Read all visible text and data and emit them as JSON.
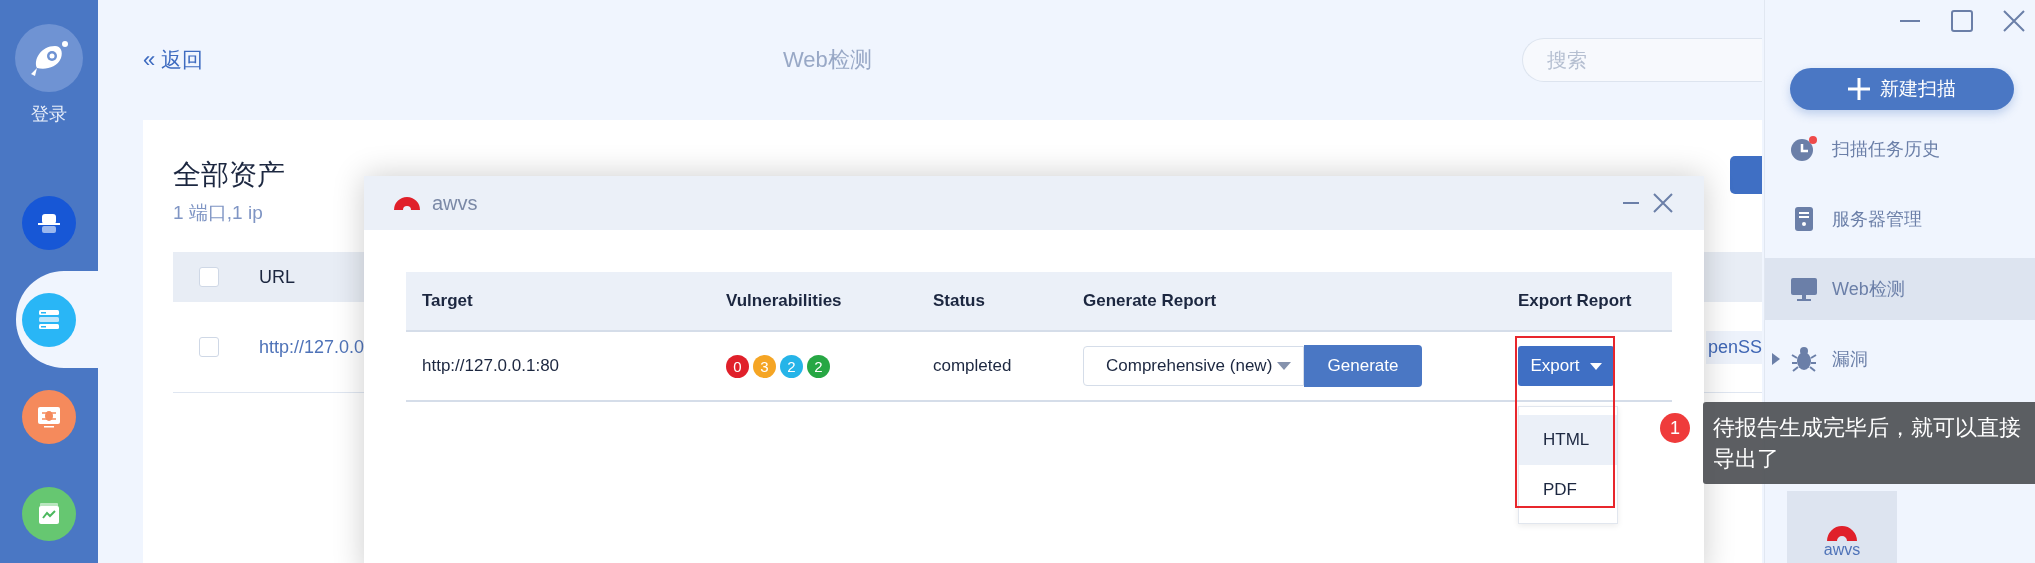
{
  "left_sidebar": {
    "login": "登录",
    "items": [
      {
        "kind": "hat",
        "selected": false
      },
      {
        "kind": "server",
        "selected": true
      },
      {
        "kind": "bug",
        "selected": false
      },
      {
        "kind": "chart",
        "selected": false
      }
    ]
  },
  "header": {
    "back_icon": "«",
    "back": "返回",
    "title": "Web检测",
    "search": {
      "placeholder": "搜索"
    }
  },
  "assets": {
    "title": "全部资产",
    "subtitle": "1 端口,1 ip",
    "columns": [
      "URL"
    ],
    "header_checked": false,
    "rows": [
      {
        "checked": false,
        "url": "http://127.0.0",
        "tag": "penSS"
      }
    ]
  },
  "dialog": {
    "title": "awvs",
    "columns": [
      "Target",
      "Vulnerabilities",
      "Status",
      "Generate Report",
      "Export Report"
    ],
    "row": {
      "target": "http://127.0.0.1:80",
      "vulnerabilities": [
        {
          "count": "0",
          "color": "#e0202a"
        },
        {
          "count": "3",
          "color": "#f5a524"
        },
        {
          "count": "2",
          "color": "#26b4e8"
        },
        {
          "count": "2",
          "color": "#27a744"
        }
      ],
      "status": "completed",
      "report_type": "Comprehensive (new)",
      "generate": "Generate",
      "export": "Export"
    },
    "export_menu": [
      {
        "label": "HTML",
        "selected": true
      },
      {
        "label": "PDF",
        "selected": false
      }
    ]
  },
  "annotation": {
    "number": "1",
    "text": "待报告生成完毕后，就可以直接导出了"
  },
  "right_sidebar": {
    "new_scan": "新建扫描",
    "items": [
      {
        "kind": "history",
        "label": "扫描任务历史",
        "selected": false,
        "notification": true
      },
      {
        "kind": "server",
        "label": "服务器管理",
        "selected": false
      },
      {
        "kind": "monitor",
        "label": "Web检测",
        "selected": true
      },
      {
        "kind": "bug",
        "label": "漏洞",
        "selected": false,
        "expanded": false
      }
    ],
    "apps": [
      {
        "label": "awvs",
        "selected": true
      }
    ]
  }
}
